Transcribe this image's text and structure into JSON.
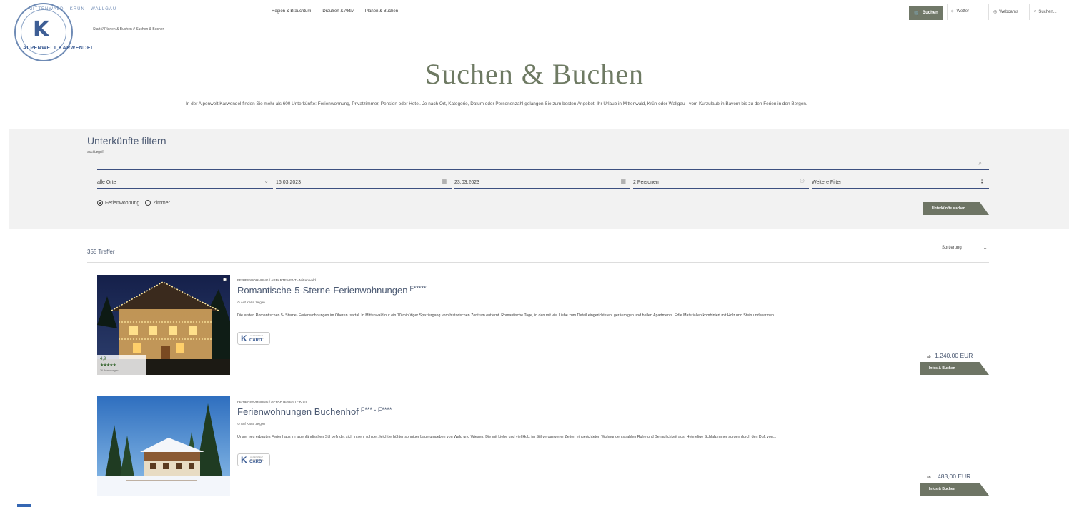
{
  "logo": {
    "arc_top": "MITTENWALD · KRÜN · WALLGAU",
    "arc_bottom": "ALPENWELT KARWENDEL",
    "letter": "K"
  },
  "nav": {
    "items": [
      "Region & Brauchtum",
      "Draußen & Aktiv",
      "Planen & Buchen"
    ]
  },
  "tools": {
    "buchen": "Buchen",
    "wetter": "Wetter",
    "webcams": "Webcams",
    "search": "Suchen..."
  },
  "breadcrumb": "Start  //  Planen & Buchen  //  Suchen & Buchen",
  "hero": {
    "title": "Suchen & Buchen",
    "text": "In der Alpenwelt Karwendel finden Sie mehr als 600 Unterkünfte: Ferienwohnung, Privatzimmer, Pension oder Hotel. Je nach Ort, Kategorie, Datum oder Personenzahl gelangen Sie zum besten Angebot. Ihr Urlaub in Mittenwald, Krün oder Wallgau - vom Kurzulaub in Bayern bis zu den Ferien in den Bergen."
  },
  "filter": {
    "title": "Unterkünfte filtern",
    "search_label": "Suchbegriff",
    "search_value": "",
    "ort": "alle Orte",
    "date_from": "16.03.2023",
    "date_to": "23.03.2023",
    "persons": "2 Personen",
    "more": "Weitere Filter",
    "radio_1": "Ferienwohnung",
    "radio_2": "Zimmer",
    "submit": "Unterkünfte suchen"
  },
  "results": {
    "count": "355 Treffer",
    "sort": "Sortierung",
    "items": [
      {
        "meta": "FERIENWOHNUNG / APPARTEMENT - Mittenwald",
        "title": "Romantische-5-Sterne-Ferienwohnungen",
        "stars": "F*****",
        "map": "Auf Karte zeigen",
        "desc": "Die ersten Romantischen 5- Sterne- Ferienwohnungen im Oberen Isartal. In Mittenwald nur ein 10-minütiger Spaziergang vom historischen Zentrum entfernt. Romantische Tage, in den mit viel Liebe zum Detail eingerichteten, geräumigen und hellen Apartments. Edle Materialien kombiniert mit Holz und Stein und warmen...",
        "badge": "CARD",
        "price_prefix": "ab",
        "price": "1.240,00 EUR",
        "button": "Infos & Buchen",
        "rating_value": "4,9",
        "rating_stars": "★★★★★",
        "rating_count": "26 Bewertungen"
      },
      {
        "meta": "FERIENWOHNUNG / APPARTEMENT - Krün",
        "title": "Ferienwohnungen Buchenhof",
        "stars": "F*** - F****",
        "map": "Auf Karte zeigen",
        "desc": "Unser neu erbautes Ferienhaus im alpenländischen Stil befindet sich in sehr ruhiger, leicht erhöhter sonniger Lage umgeben von Wald und Wiesen. Die mit Liebe und viel Holz im Stil vergangener Zeiten eingerichteten Wohnungen strahlen Ruhe und Behaglichkeit aus. Heimelige Schlafzimmer sorgen durch den Duft von...",
        "badge": "CARD",
        "price_prefix": "ab",
        "price": "483,00 EUR",
        "button": "Infos & Buchen"
      }
    ]
  },
  "colors": {
    "accent_green": "#6e7565",
    "title_blue": "#4c5a73",
    "line_blue": "#3d5080"
  }
}
